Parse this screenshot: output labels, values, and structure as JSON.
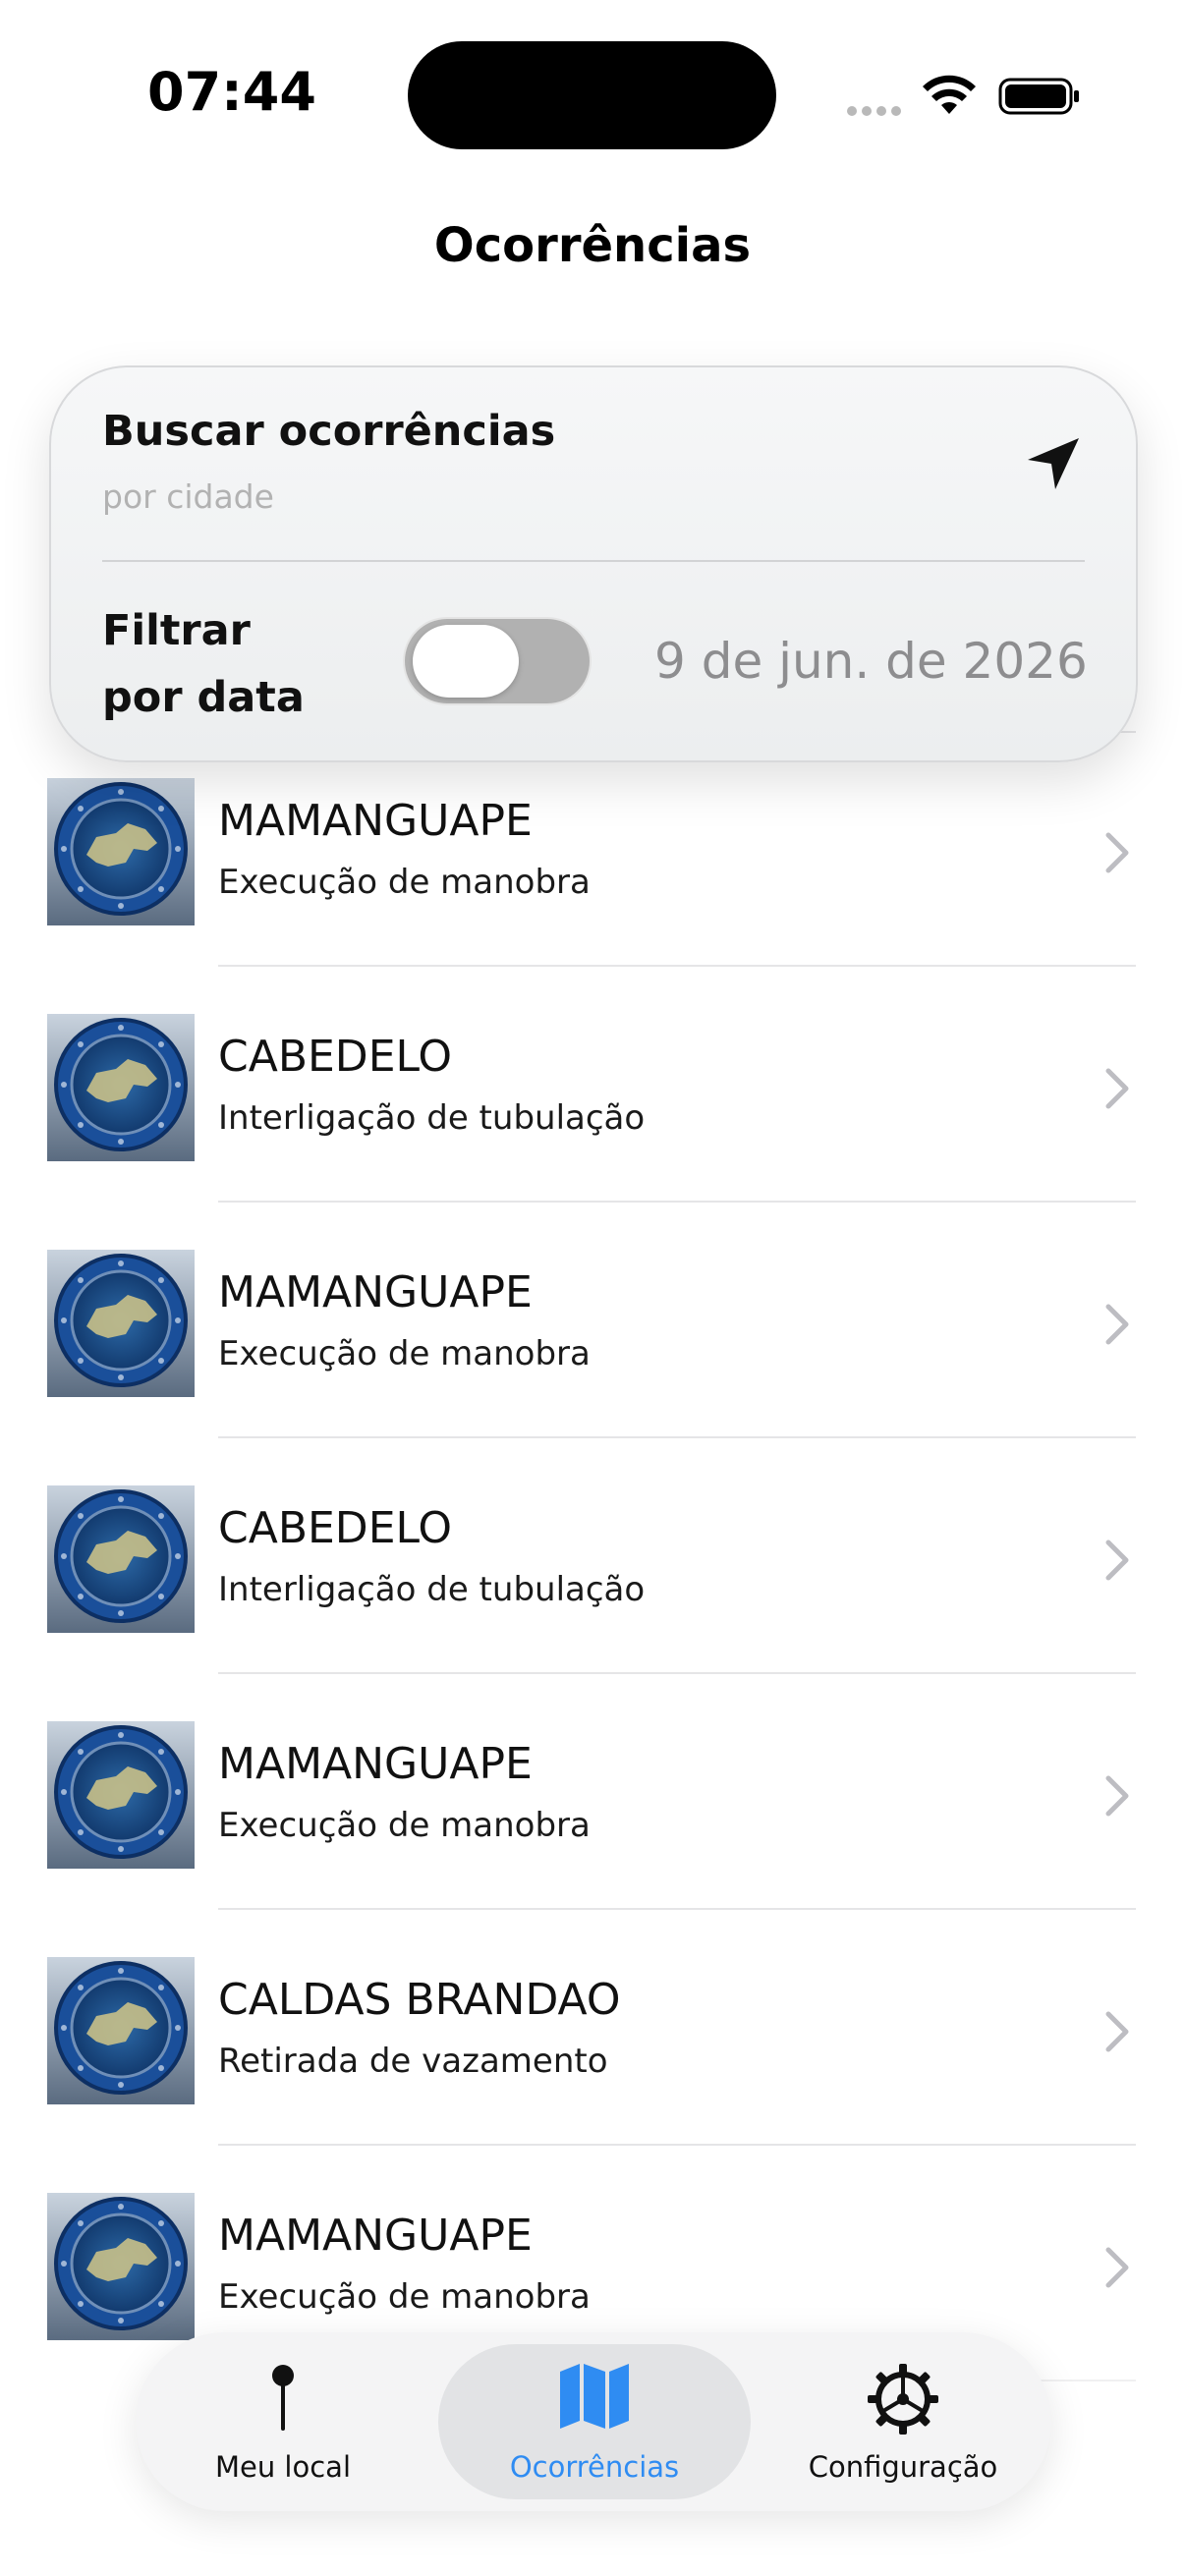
{
  "status_bar": {
    "time": "07:44"
  },
  "nav": {
    "title": "Ocorrências"
  },
  "search": {
    "title": "Buscar ocorrências",
    "placeholder": "por cidade",
    "filter_label_line1": "Filtrar",
    "filter_label_line2": "por data",
    "filter_enabled": false,
    "date": "9 de jun. de 2026"
  },
  "occurrences": [
    {
      "city": "MAMANGUAPE",
      "type": "Execução de manobra"
    },
    {
      "city": "CABEDELO",
      "type": "Interligação de tubulação"
    },
    {
      "city": "MAMANGUAPE",
      "type": "Execução de manobra"
    },
    {
      "city": "CABEDELO",
      "type": "Interligação de tubulação"
    },
    {
      "city": "MAMANGUAPE",
      "type": "Execução de manobra"
    },
    {
      "city": "CALDAS BRANDAO",
      "type": "Retirada de vazamento"
    },
    {
      "city": "MAMANGUAPE",
      "type": "Execução de manobra"
    }
  ],
  "tabs": [
    {
      "label": "Meu local",
      "icon": "pin-icon",
      "active": false
    },
    {
      "label": "Ocorrências",
      "icon": "map-icon",
      "active": true
    },
    {
      "label": "Configuração",
      "icon": "gear-icon",
      "active": false
    }
  ],
  "colors": {
    "accent": "#2f8cf2",
    "text": "#111111",
    "secondary": "#8d8d8f"
  }
}
